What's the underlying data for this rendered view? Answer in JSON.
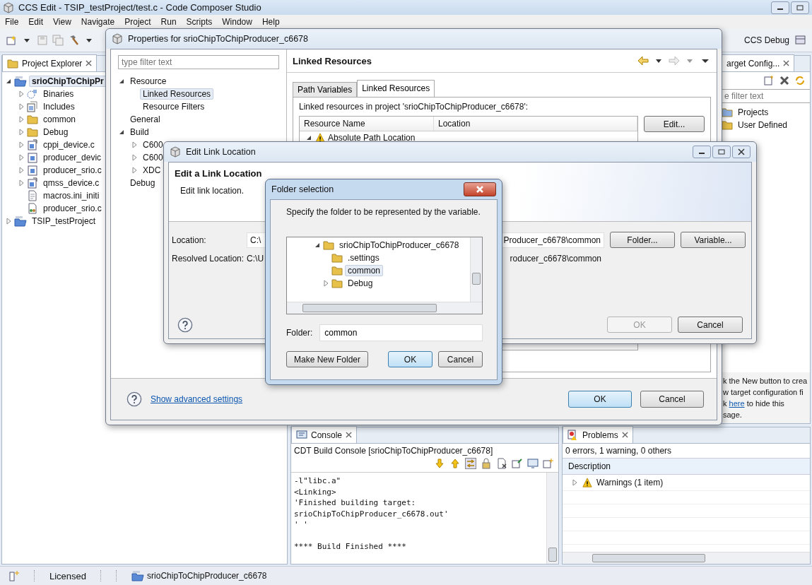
{
  "main_window": {
    "title": "CCS Edit - TSIP_testProject/test.c - Code Composer Studio"
  },
  "menu": [
    "File",
    "Edit",
    "View",
    "Navigate",
    "Project",
    "Run",
    "Scripts",
    "Window",
    "Help"
  ],
  "perspective": {
    "label": "CCS Debug"
  },
  "project_explorer": {
    "title": "Project Explorer",
    "tree": [
      {
        "label": "srioChipToChipPr",
        "kind": "project",
        "expanded": true,
        "selected": true,
        "children": [
          {
            "label": "Binaries",
            "kind": "binaries",
            "expanded": false,
            "selected": false
          },
          {
            "label": "Includes",
            "kind": "includes",
            "expanded": false,
            "selected": false
          },
          {
            "label": "common",
            "kind": "linked-folder",
            "expanded": false,
            "selected": false
          },
          {
            "label": "Debug",
            "kind": "folder",
            "expanded": false,
            "selected": false
          },
          {
            "label": "cppi_device.c",
            "kind": "linked-file",
            "expanded": false,
            "selected": false
          },
          {
            "label": "producer_devic",
            "kind": "c-file",
            "expanded": false,
            "selected": false
          },
          {
            "label": "producer_srio.c",
            "kind": "c-file",
            "expanded": false,
            "selected": false
          },
          {
            "label": "qmss_device.c",
            "kind": "linked-file",
            "expanded": false,
            "selected": false
          },
          {
            "label": "macros.ini_initi",
            "kind": "text-file",
            "selected": false
          },
          {
            "label": "producer_srio.c",
            "kind": "config-file",
            "selected": false
          }
        ]
      },
      {
        "label": "TSIP_testProject",
        "kind": "project",
        "expanded": false,
        "selected": false
      }
    ]
  },
  "target_configurations": {
    "title": "arget Config...",
    "filter_placeholder": "e filter text",
    "items": [
      {
        "label": "Projects",
        "kind": "project-folder"
      },
      {
        "label": "User Defined",
        "kind": "folder"
      }
    ],
    "message_lines": [
      {
        "text": "k the New button to crea"
      },
      {
        "text": "w target configuration fi"
      },
      {
        "text": "k ",
        "link": "here",
        "after": " to hide this"
      },
      {
        "text": "sage."
      }
    ]
  },
  "console": {
    "title": "Console",
    "subtitle": "CDT Build Console [srioChipToChipProducer_c6678]",
    "paragraphs": [
      [
        "-l\"libc.a\"",
        "<Linking>",
        "'Finished building target:",
        "srioChipToChipProducer_c6678.out'",
        "' '"
      ],
      [
        "**** Build Finished ****"
      ]
    ]
  },
  "problems": {
    "title": "Problems",
    "summary": "0 errors, 1 warning, 0 others",
    "columns": [
      "Description"
    ],
    "rows": [
      {
        "label": "Warnings (1 item)",
        "expanded": false
      }
    ]
  },
  "status_bar": {
    "license": "Licensed",
    "project": "srioChipToChipProducer_c6678"
  },
  "properties_dialog": {
    "title": "Properties for srioChipToChipProducer_c6678",
    "filter_placeholder": "type filter text",
    "tree": [
      {
        "label": "Resource",
        "expanded": true,
        "selected": false,
        "children": [
          {
            "label": "Linked Resources",
            "selected": true
          },
          {
            "label": "Resource Filters",
            "selected": false
          }
        ]
      },
      {
        "label": "General",
        "selected": false
      },
      {
        "label": "Build",
        "expanded": true,
        "selected": false,
        "children": [
          {
            "label": "C600",
            "expanded": false,
            "selected": false
          },
          {
            "label": "C600",
            "expanded": false,
            "selected": false
          },
          {
            "label": "XDC",
            "expanded": false,
            "selected": false
          }
        ]
      },
      {
        "label": "Debug",
        "selected": false
      }
    ],
    "page_title": "Linked Resources",
    "tabs": [
      {
        "label": "Path Variables",
        "selected": false
      },
      {
        "label": "Linked Resources",
        "selected": true
      }
    ],
    "description": "Linked resources in project 'srioChipToChipProducer_c6678':",
    "columns": [
      "Resource Name",
      "Location"
    ],
    "rows": [
      {
        "name": "Absolute Path Location",
        "expanded": true
      }
    ],
    "side_buttons": [
      "Edit..."
    ],
    "advanced_link": "Show advanced settings",
    "buttons": [
      {
        "label": "OK",
        "default": true
      },
      {
        "label": "Cancel",
        "default": false
      }
    ]
  },
  "edit_link_dialog": {
    "title": "Edit Link Location",
    "heading": "Edit a Link Location",
    "description": "Edit link location.",
    "location": {
      "label": "Location:",
      "value_start": "C:\\",
      "value_end": "Producer_c6678\\common"
    },
    "resolved": {
      "label": "Resolved Location:",
      "value_start": "C:\\U",
      "value_end": "roducer_c6678\\common"
    },
    "field_buttons": [
      "Folder...",
      "Variable..."
    ],
    "buttons": [
      {
        "label": "OK",
        "disabled": true
      },
      {
        "label": "Cancel",
        "disabled": false
      }
    ]
  },
  "folder_dialog": {
    "title": "Folder selection",
    "prompt": "Specify the folder to be represented by the variable.",
    "tree": [
      {
        "label": "srioChipToChipProducer_c6678",
        "expanded": true,
        "selected": false,
        "children": [
          {
            "label": ".settings",
            "selected": false
          },
          {
            "label": "common",
            "selected": true
          },
          {
            "label": "Debug",
            "expanded": false,
            "selected": false
          }
        ]
      }
    ],
    "folder": {
      "label": "Folder:",
      "value": "common"
    },
    "buttons": [
      {
        "label": "Make New Folder",
        "default": false
      },
      {
        "label": "OK",
        "default": true
      },
      {
        "label": "Cancel",
        "default": false
      }
    ]
  }
}
